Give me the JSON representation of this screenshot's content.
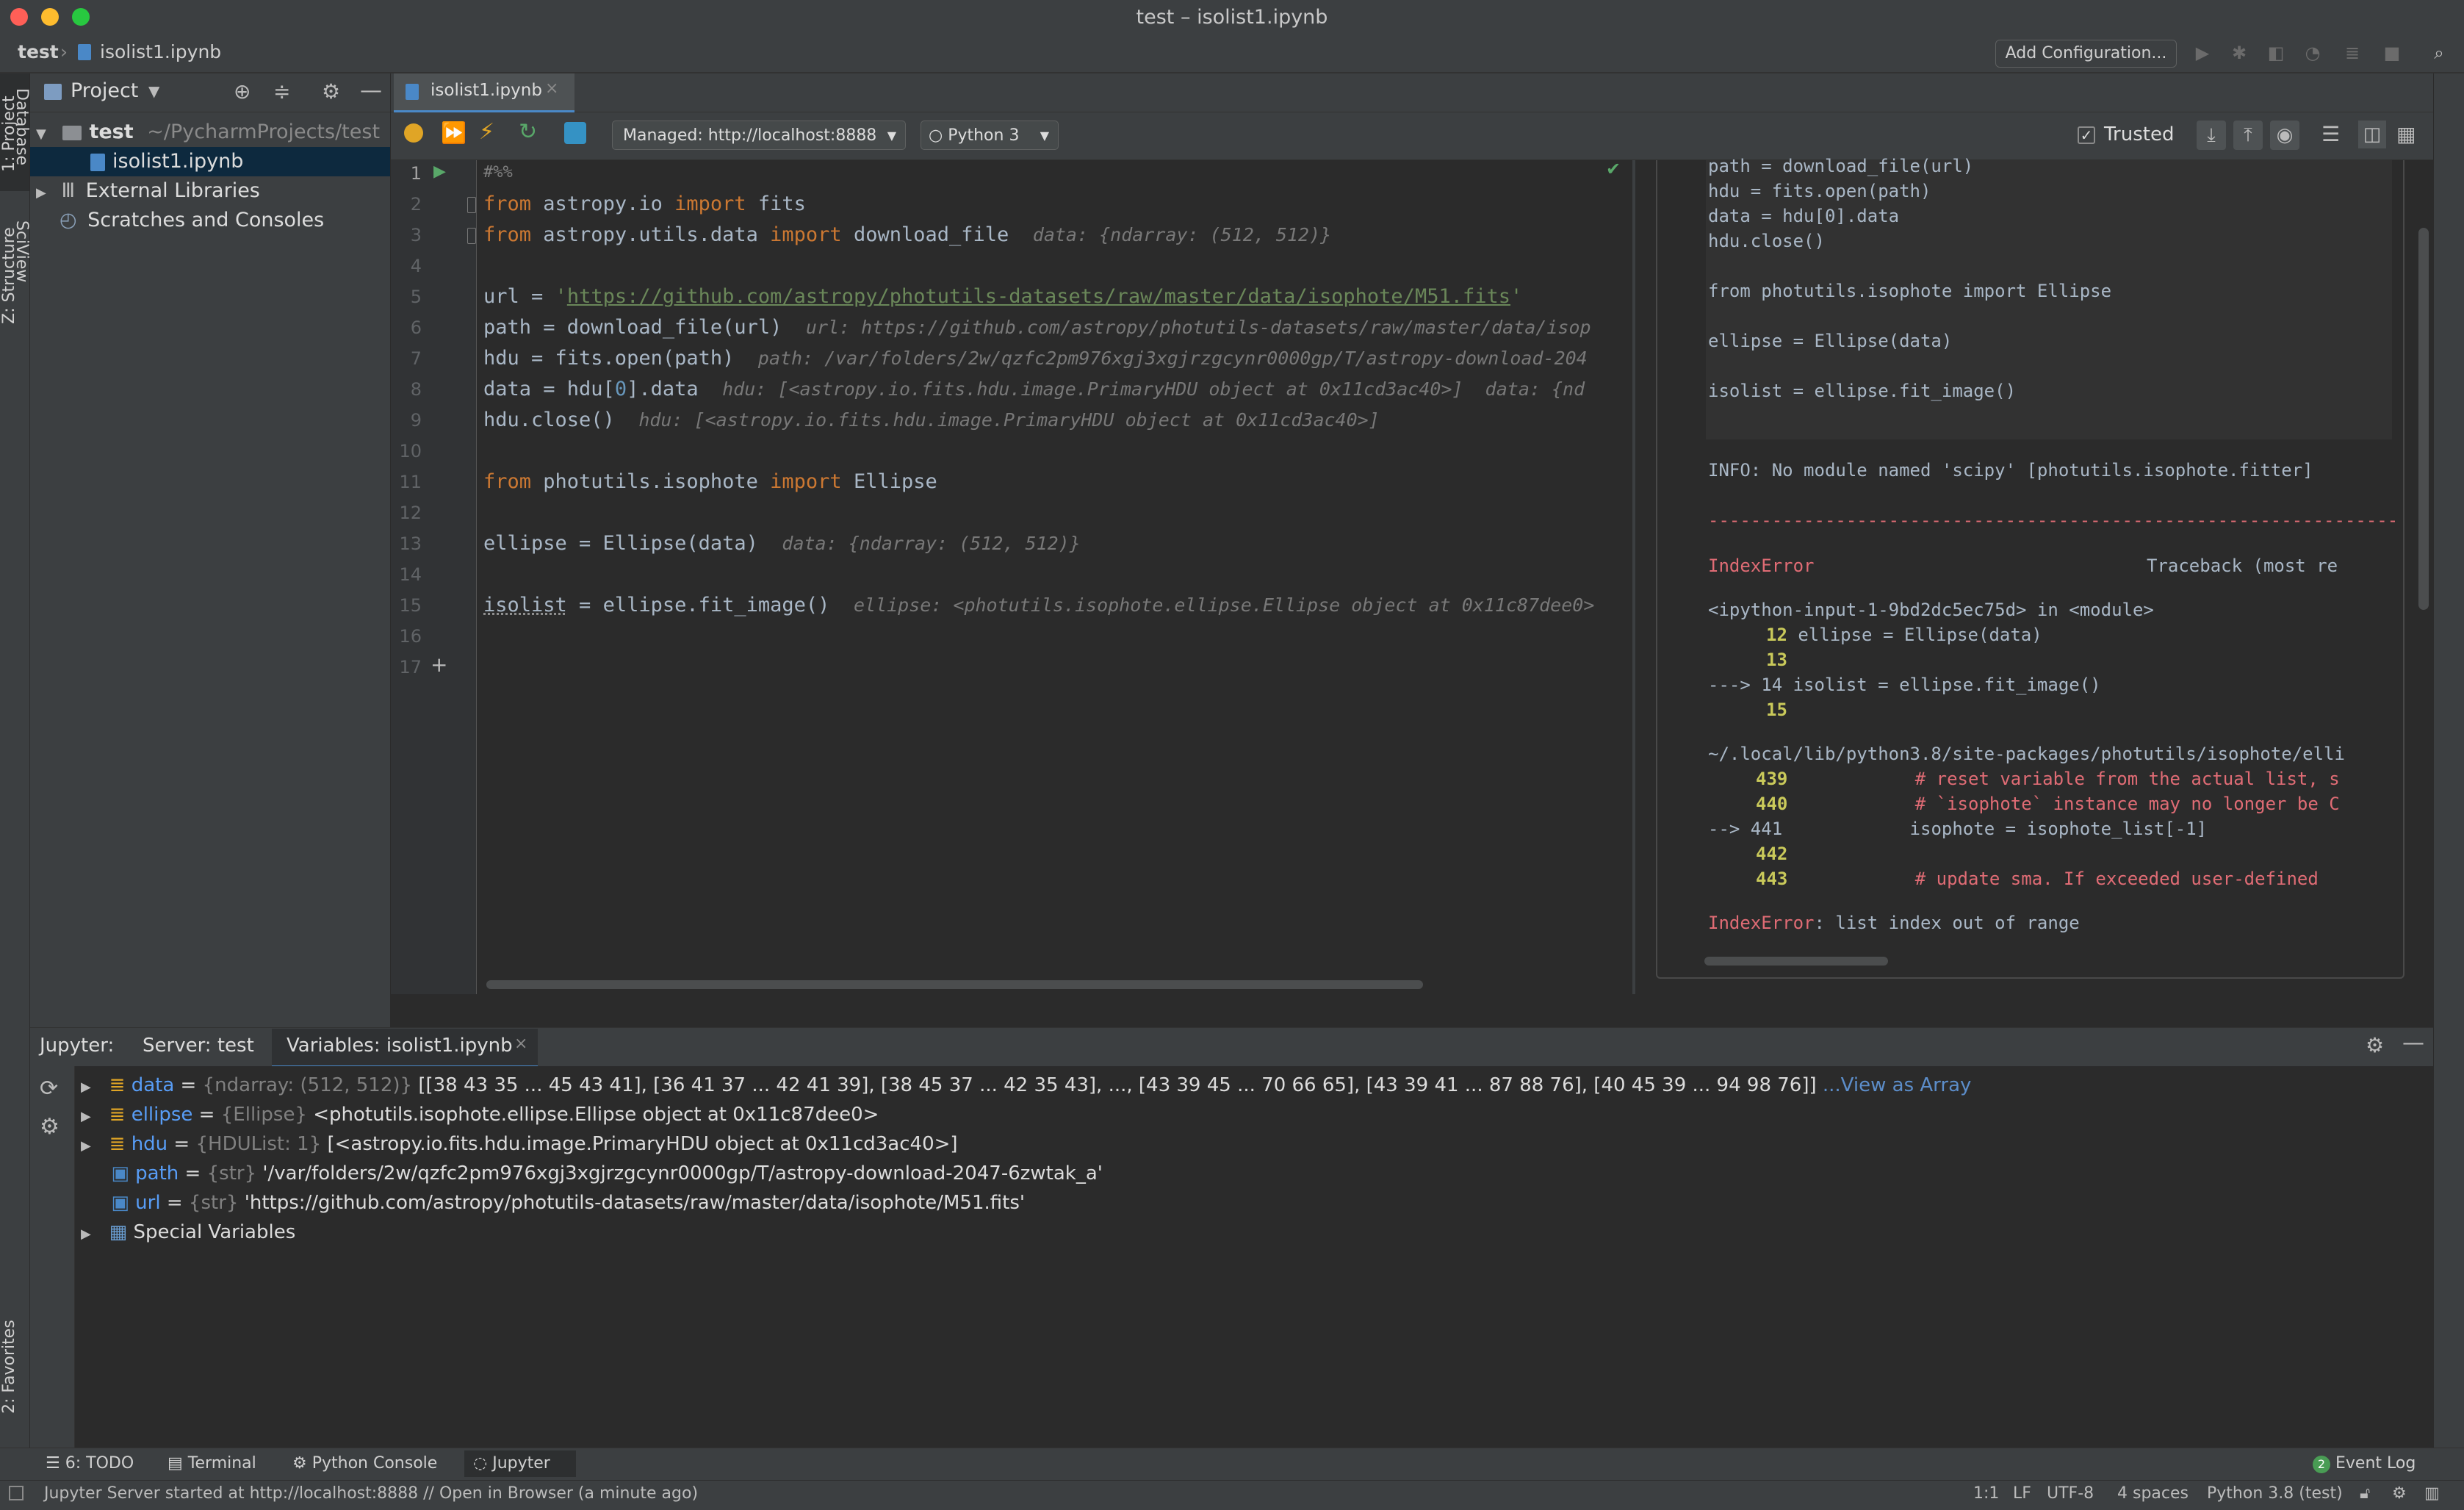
{
  "window": {
    "title": "test – isolist1.ipynb"
  },
  "breadcrumb": {
    "project": "test",
    "file": "isolist1.ipynb"
  },
  "toolbar": {
    "add_configuration": "Add Configuration..."
  },
  "left_stripe": {
    "project_tab": "1: Project",
    "structure_tab": "Z: Structure",
    "favorites_tab": "2: Favorites"
  },
  "right_stripe": {
    "database_tab": "Database",
    "sciview_tab": "SciView"
  },
  "project_panel": {
    "title": "Project",
    "root_name": "test",
    "root_path": "~/PycharmProjects/test",
    "items": [
      {
        "label": "isolist1.ipynb"
      },
      {
        "label": "External Libraries"
      },
      {
        "label": "Scratches and Consoles"
      }
    ]
  },
  "editor": {
    "tab_label": "isolist1.ipynb",
    "server_combo": "Managed: http://localhost:8888",
    "kernel_combo": "Python 3",
    "trusted_label": "Trusted",
    "line_numbers": [
      "1",
      "2",
      "3",
      "4",
      "5",
      "6",
      "7",
      "8",
      "9",
      "10",
      "11",
      "12",
      "13",
      "14",
      "15",
      "16",
      "17"
    ],
    "lines": {
      "l1": "#%%",
      "l2_kw1": "from",
      "l2_mod": " astropy.io ",
      "l2_kw2": "import",
      "l2_name": " fits",
      "l3_kw1": "from",
      "l3_mod": " astropy.utils.data ",
      "l3_kw2": "import",
      "l3_name": " download_file",
      "l3_hint": "data: {ndarray: (512, 512)}",
      "l5_pre": "url = ",
      "l5_q1": "'",
      "l5_url": "https://github.com/astropy/photutils-datasets/raw/master/data/isophote/M51.fits",
      "l5_q2": "'",
      "l6_code": "path = download_file(url)",
      "l6_hint": "url: https://github.com/astropy/photutils-datasets/raw/master/data/isop",
      "l7_code": "hdu = fits.open(path)",
      "l7_hint": "path: /var/folders/2w/qzfc2pm976xgj3xgjrzgcynr0000gp/T/astropy-download-204",
      "l8_pre": "data = hdu[",
      "l8_num": "0",
      "l8_post": "].data",
      "l8_hint": "hdu: [<astropy.io.fits.hdu.image.PrimaryHDU object at 0x11cd3ac40>]  data: {nd",
      "l9_code": "hdu.close()",
      "l9_hint": "hdu: [<astropy.io.fits.hdu.image.PrimaryHDU object at 0x11cd3ac40>]",
      "l11_kw1": "from",
      "l11_mod": " photutils.isophote ",
      "l11_kw2": "import",
      "l11_name": " Ellipse",
      "l13_code": "ellipse = Ellipse(data)",
      "l13_hint": "data: {ndarray: (512, 512)}",
      "l15_var": "isolist",
      "l15_rest": " = ellipse.fit_image()",
      "l15_hint": "ellipse: <photutils.isophote.ellipse.Ellipse object at 0x11c87dee0>"
    }
  },
  "output": {
    "code_lines": [
      "path = download_file(url)",
      "hdu = fits.open(path)",
      "data = hdu[0].data",
      "hdu.close()",
      "",
      "from photutils.isophote import Ellipse",
      "",
      "ellipse = Ellipse(data)",
      "",
      "isolist = ellipse.fit_image()"
    ],
    "info": "INFO: No module named 'scipy' [photutils.isophote.fitter]",
    "separator": "---------------------------------------------------------------------------",
    "error_name": "IndexError",
    "traceback_header": "Traceback (most re",
    "frame1": "<ipython-input-1-9bd2dc5ec75d> in <module>",
    "f1_l12": "12",
    "f1_l12_code": " ellipse = Ellipse(data)",
    "f1_l13": "13",
    "f1_arrow": "---> 14 isolist = ellipse.fit_image()",
    "f1_l15": "15",
    "frame2": "~/.local/lib/python3.8/site-packages/photutils/isophote/elli",
    "f2_l439": "439",
    "f2_l439_code": "            # reset variable from the actual list, s",
    "f2_l440": "440",
    "f2_l440_code": "            # `isophote` instance may no longer be C",
    "f2_arrow": "--> 441",
    "f2_arrow_code": "            isophote = isophote_list[-1]",
    "f2_l442": "442",
    "f2_l443": "443",
    "f2_l443_code": "            # update sma. If exceeded user-defined",
    "final_error_name": "IndexError",
    "final_error_msg": ": list index out of range"
  },
  "bottom_panel": {
    "jupyter_label": "Jupyter:",
    "server_tab": "Server: test",
    "variables_tab": "Variables: isolist1.ipynb",
    "variables": [
      {
        "name": "data",
        "type": "{ndarray: (512, 512)}",
        "value": "[[38 43 35 ... 45 43 41], [36 41 37 ... 42 41 39], [38 45 37 ... 42 35 43], ..., [43 39 45 ... 70 66 65], [43 39 41 ... 87 88 76], [40 45 39 ... 94 98 76]]",
        "link": "...View as Array"
      },
      {
        "name": "ellipse",
        "type": "{Ellipse}",
        "value": "<photutils.isophote.ellipse.Ellipse object at 0x11c87dee0>"
      },
      {
        "name": "hdu",
        "type": "{HDUList: 1}",
        "value": "[<astropy.io.fits.hdu.image.PrimaryHDU object at 0x11cd3ac40>]"
      },
      {
        "name": "path",
        "type": "{str}",
        "value": "'/var/folders/2w/qzfc2pm976xgj3xgjrzgcynr0000gp/T/astropy-download-2047-6zwtak_a'"
      },
      {
        "name": "url",
        "type": "{str}",
        "value": "'https://github.com/astropy/photutils-datasets/raw/master/data/isophote/M51.fits'"
      },
      {
        "name": "Special Variables"
      }
    ]
  },
  "tool_tabs": {
    "todo": "6: TODO",
    "terminal": "Terminal",
    "python_console": "Python Console",
    "jupyter": "Jupyter",
    "event_log": "Event Log",
    "event_count": "2"
  },
  "status": {
    "message": "Jupyter Server started at http://localhost:8888 // Open in Browser (a minute ago)",
    "position": "1:1",
    "line_sep": "LF",
    "encoding": "UTF-8",
    "indent": "4 spaces",
    "interpreter": "Python 3.8 (test)"
  },
  "colors": {
    "accent": "#4a88c7",
    "keyword": "#cc7832",
    "string": "#6a8759",
    "error": "#e06c75"
  }
}
